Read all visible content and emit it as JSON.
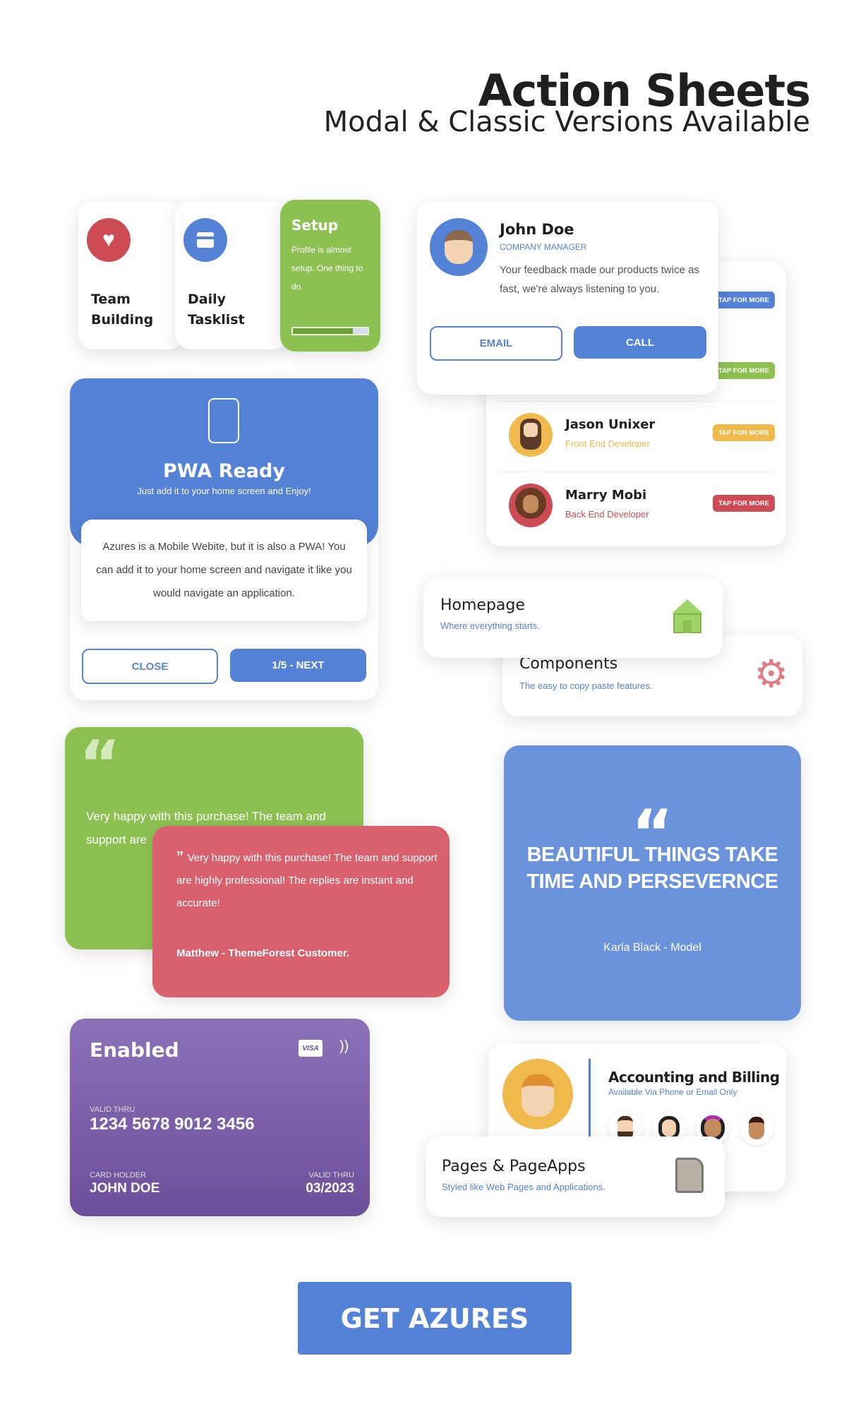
{
  "header": {
    "title": "Action Sheets",
    "subtitle": "Modal & Classic Versions Available"
  },
  "tiles": [
    {
      "label_1": "Team",
      "label_2": "Building",
      "icon": "heart-icon",
      "color": "#cc4b55"
    },
    {
      "label_1": "Daily",
      "label_2": "Tasklist",
      "icon": "calendar-icon",
      "color": "#5482d6"
    }
  ],
  "setup": {
    "title": "Setup",
    "text": "Profile is almost setup. One thing to do.",
    "progress": 0.8
  },
  "profile": {
    "name": "John Doe",
    "role": "COMPANY MANAGER",
    "text": "Your feedback made our products twice as fast, we're always listening to you.",
    "email": "EMAIL",
    "call": "CALL"
  },
  "contacts": [
    {
      "tag": "TAP FOR MORE",
      "color": "#5482d6"
    },
    {
      "tag": "TAP FOR MORE",
      "color": "#8cc152"
    },
    {
      "name": "Jason Unixer",
      "role": "Front End Developer",
      "tag": "TAP FOR MORE",
      "color": "#f0b94b"
    },
    {
      "name": "Marry Mobi",
      "role": "Back End Developer",
      "tag": "TAP FOR MORE",
      "color": "#cc4b55"
    }
  ],
  "pwa": {
    "title": "PWA Ready",
    "subtitle": "Just add it to your home screen and Enjoy!",
    "text": "Azures is a Mobile Webite, but it is also a PWA! You can add it to your home screen and navigate it like you would navigate an application.",
    "close": "CLOSE",
    "next": "1/5 - NEXT"
  },
  "homepage": {
    "title": "Homepage",
    "subtitle": "Where everything starts."
  },
  "components": {
    "title": "Components",
    "subtitle": "The easy to copy paste features."
  },
  "testimonial_green": {
    "text": "Very happy with this purchase! The team and support are"
  },
  "testimonial_red": {
    "text": "Very happy with this purchase! The team and support are highly professional! The replies are instant and accurate!",
    "author": "Matthew - ThemeForest Customer."
  },
  "quote": {
    "text": "BEAUTIFUL THINGS TAKE TIME AND PERSEVERNCE",
    "author": "Karla Black - Model"
  },
  "credit_card": {
    "status": "Enabled",
    "brand": "VISA",
    "number_label": "VALID THRU",
    "number": "1234 5678 9012 3456",
    "holder_label": "CARD HOLDER",
    "holder": "JOHN DOE",
    "valid_label": "VALID THRU",
    "valid": "03/2023"
  },
  "accounting": {
    "title": "Accounting and Billing",
    "subtitle": "Available Via Phone or Email Only"
  },
  "pages": {
    "title": "Pages & PageApps",
    "subtitle": "Styled like Web Pages and Applications."
  },
  "cta": {
    "label": "GET AZURES"
  },
  "colors": {
    "blue": "#5482d6",
    "green": "#8cc152",
    "red": "#cc4b55",
    "yellow": "#f0b94b",
    "purple": "#7a5aa8"
  }
}
